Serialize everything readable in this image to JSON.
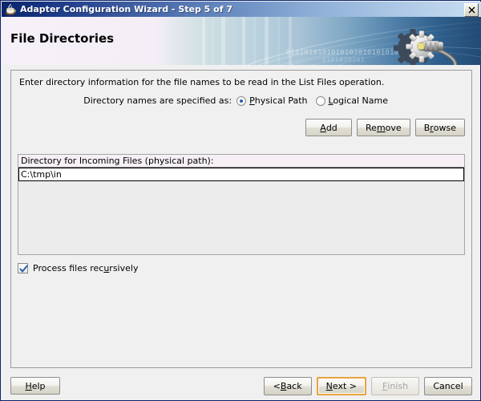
{
  "window": {
    "title": "Adapter Configuration Wizard - Step 5 of 7",
    "app_icon": "wizard-icon",
    "close_label": "✕"
  },
  "banner": {
    "page_title": "File Directories",
    "decoration": "gear-cable-graphic",
    "binary_text": "01010101010101010101010101",
    "binary_text_2": "0101010101"
  },
  "content": {
    "instruction": "Enter directory information for the file names to be read in the List Files operation.",
    "radio_group": {
      "label": "Directory names are specified as:",
      "options": [
        {
          "label_prefix": "",
          "mnemonic": "P",
          "label_suffix": "hysical Path",
          "selected": true
        },
        {
          "label_prefix": "",
          "mnemonic": "L",
          "label_suffix": "ogical Name",
          "selected": false
        }
      ]
    },
    "action_buttons": [
      {
        "prefix": "",
        "mnemonic": "A",
        "suffix": "dd"
      },
      {
        "prefix": "Re",
        "mnemonic": "m",
        "suffix": "ove"
      },
      {
        "prefix": "B",
        "mnemonic": "r",
        "suffix": "owse"
      }
    ],
    "directory_table": {
      "column_header": "Directory for Incoming Files (physical path):",
      "rows": [
        {
          "value": "C:\\tmp\\in",
          "editing": true
        }
      ]
    },
    "recursive_checkbox": {
      "prefix": "Process files rec",
      "mnemonic": "u",
      "suffix": "rsively",
      "checked": true
    }
  },
  "footer": {
    "help": {
      "prefix": "",
      "mnemonic": "H",
      "suffix": "elp"
    },
    "back": {
      "prefix": "< ",
      "mnemonic": "B",
      "suffix": "ack"
    },
    "next": {
      "prefix": "",
      "mnemonic": "N",
      "suffix": "ext >",
      "focused": true
    },
    "finish": {
      "prefix": "",
      "mnemonic": "F",
      "suffix": "inish",
      "disabled": true
    },
    "cancel": {
      "prefix": "Cancel",
      "mnemonic": "",
      "suffix": ""
    }
  },
  "colors": {
    "titlebar_start": "#0a246a",
    "titlebar_end": "#c8ddf2",
    "focus_border": "#e8a33d",
    "radio_dot": "#2b5fad",
    "check_mark": "#2b5fad",
    "panel_bg": "#f0f0f0"
  }
}
